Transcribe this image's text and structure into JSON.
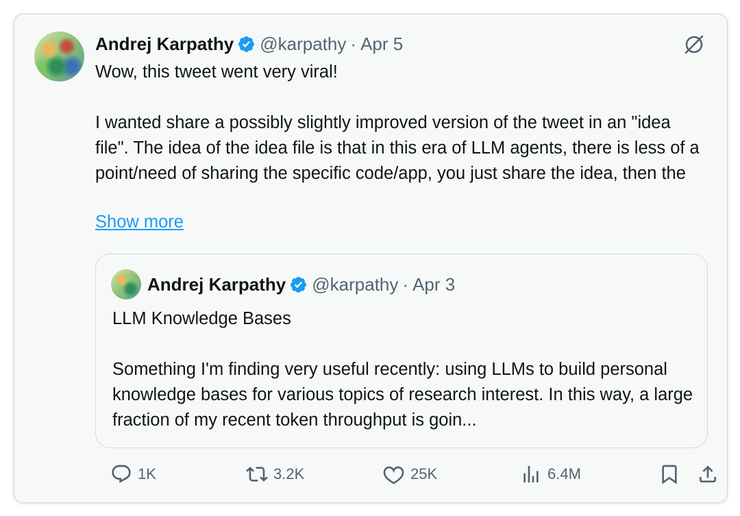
{
  "tweet": {
    "author_name": "Andrej Karpathy",
    "handle": "@karpathy",
    "separator": "·",
    "date": "Apr 5",
    "paragraphs": [
      "Wow, this tweet went very viral!",
      "I wanted share a possibly slightly improved version of the tweet in an \"idea file\". The idea of the idea file is that in this era of LLM agents, there is less of a point/need of sharing the specific code/app, you just share the idea, then the"
    ],
    "show_more": "Show more"
  },
  "quoted": {
    "author_name": "Andrej Karpathy",
    "handle": "@karpathy",
    "separator": "·",
    "date": "Apr 3",
    "paragraphs": [
      "LLM Knowledge Bases",
      "Something I'm finding very useful recently: using LLMs to build personal knowledge bases for various topics of research interest. In this way, a large fraction of my recent token throughput is goin..."
    ]
  },
  "actions": {
    "replies": "1K",
    "reposts": "3.2K",
    "likes": "25K",
    "views": "6.4M"
  },
  "icons": {
    "verified": "verified-badge-icon",
    "grok": "grok-icon",
    "reply": "reply-icon",
    "repost": "repost-icon",
    "like": "heart-icon",
    "views": "views-icon",
    "bookmark": "bookmark-icon",
    "share": "share-icon"
  },
  "colors": {
    "verified": "#1d9bf0",
    "link": "#1d9bf0",
    "muted": "#536471",
    "text": "#0f1419"
  }
}
